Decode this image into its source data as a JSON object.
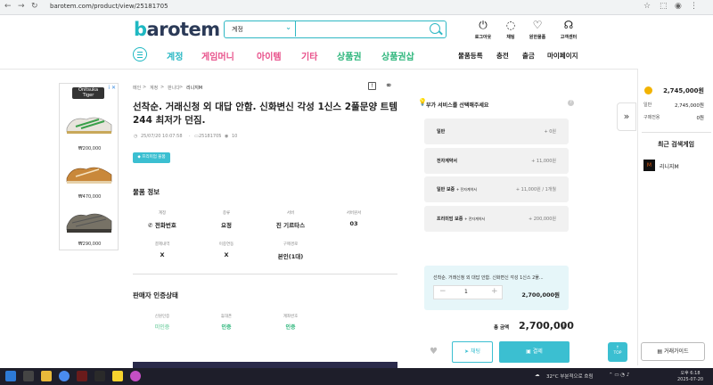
{
  "browser": {
    "url": "barotem.com/product/view/25181705"
  },
  "header": {
    "logo_prefix": "b",
    "logo_rest": "arotem",
    "search": {
      "selected": "계정",
      "placeholder": ""
    },
    "tools": [
      {
        "icon": "power-icon",
        "label": "로그아웃"
      },
      {
        "icon": "chat-icon",
        "label": "채팅"
      },
      {
        "icon": "heart-icon",
        "label": "원한물품"
      },
      {
        "icon": "headset-icon",
        "label": "고객센터"
      }
    ],
    "main_nav": [
      {
        "label": "계정",
        "color": "#2bb8c4"
      },
      {
        "label": "게임머니",
        "color": "#e8508a"
      },
      {
        "label": "아이템",
        "color": "#e8508a"
      },
      {
        "label": "기타",
        "color": "#e8508a"
      },
      {
        "label": "상품권",
        "color": "#2bb57a"
      },
      {
        "label": "상품권삽",
        "color": "#2bb57a"
      }
    ],
    "right_nav": [
      "물품등록",
      "충전",
      "출금",
      "마이페이지"
    ]
  },
  "ad": {
    "info": "i ✕",
    "brand": "Onitsuka Tiger",
    "prices": [
      "₩200,000",
      "₩470,000",
      "₩290,000"
    ]
  },
  "breadcrumb": [
    "메인",
    "계정",
    "판니다",
    "리니지M"
  ],
  "product": {
    "title": "선착순. 거래신청 외 대답 안함. 신화변신 각성 1신스 2풀문양 트템 244 최저가 던짐.",
    "date": "25/07/20 10:07:58",
    "id": "25181705",
    "views": "10",
    "premium_tag": "프리미엄 물품"
  },
  "info": {
    "section_title": "물품 정보",
    "row1": [
      {
        "label": "계정",
        "value": "전화번호"
      },
      {
        "label": "종류",
        "value": "요정"
      },
      {
        "label": "서버",
        "value": "진 기르타스"
      },
      {
        "label": "서버원서",
        "value": "03"
      }
    ],
    "row2": [
      {
        "label": "결제내역",
        "value": "X"
      },
      {
        "label": "이중연동",
        "value": "X"
      },
      {
        "label": "구매경로",
        "value": "본인(1대)"
      }
    ]
  },
  "seller": {
    "section_title": "판매자 인증상태",
    "items": [
      {
        "label": "신원인증",
        "value": "미인증"
      },
      {
        "label": "휴대폰",
        "value": "인증"
      },
      {
        "label": "계좌번호",
        "value": "인증"
      }
    ]
  },
  "panel": {
    "title": "부가 서비스를 선택해주세요",
    "options": [
      {
        "name": "일반",
        "sub": "",
        "price": "+ 0원"
      },
      {
        "name": "전자계약서",
        "sub": "",
        "price": "+ 11,000원"
      },
      {
        "name": "일반 보증",
        "sub": "+ 전자계약서",
        "price": "+ 11,000원 / 1개월"
      },
      {
        "name": "프리미엄 보증",
        "sub": "+ 전자계약서",
        "price": "+ 200,000원"
      }
    ],
    "selection_title": "선착순. 거래신청 외 대답 안함. 신화변신 각성 1신스 2풀...",
    "quantity": "1",
    "item_price": "2,700,000원",
    "total_label": "총 금액",
    "total": "2,700,000",
    "total_unit": "원",
    "chat_button": "채팅",
    "pay_button": "결제"
  },
  "rightbar": {
    "balance": "2,745,000원",
    "general_label": "일반",
    "general_value": "2,745,000원",
    "purchase_label": "구매전용",
    "purchase_value": "0원",
    "recent_title": "최근 검색게임",
    "recent_game": "리니지M",
    "guide_button": "거래가이드",
    "top_button": "TOP"
  },
  "taskbar": {
    "weather": "32°C 부분적으로 흐림",
    "time": "오후 6:18",
    "date": "2025-07-20"
  }
}
